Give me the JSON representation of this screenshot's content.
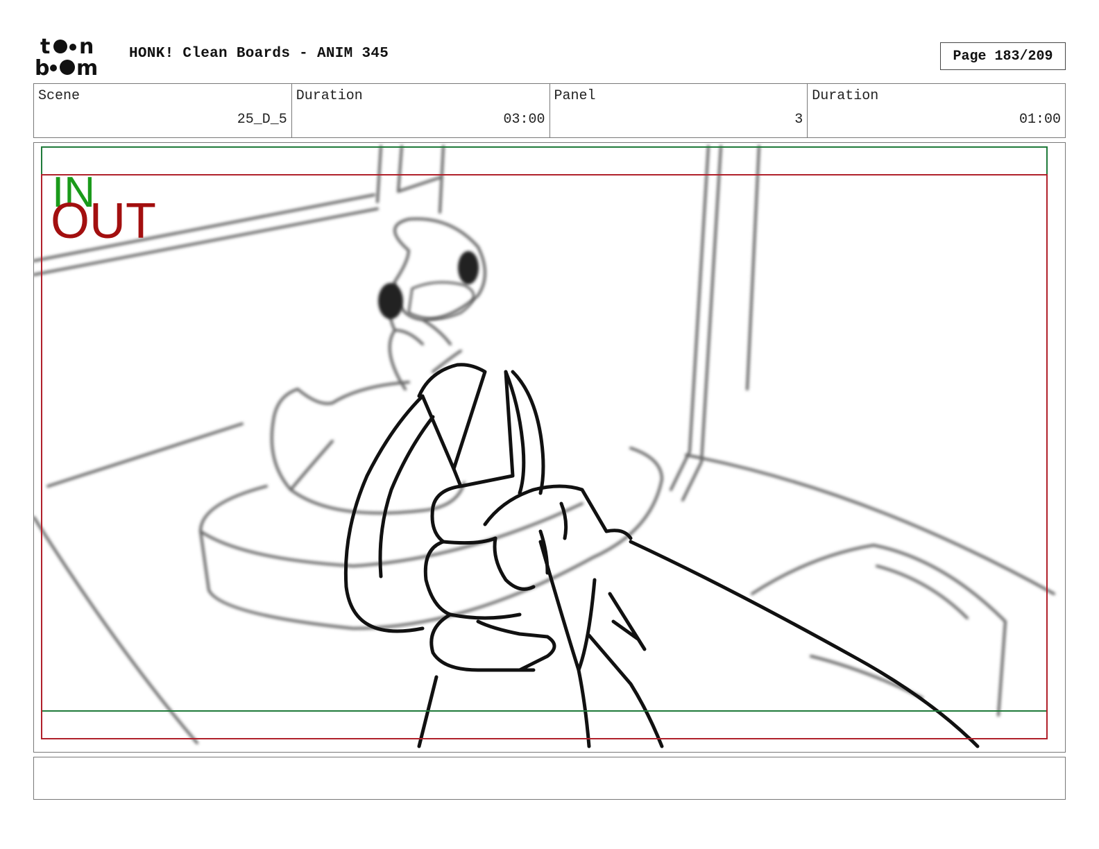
{
  "header": {
    "logo_text": "toon boom",
    "title": "HONK! Clean Boards - ANIM 345",
    "page": "Page 183/209"
  },
  "info": {
    "scene_label": "Scene",
    "scene_value": "25_D_5",
    "scene_duration_label": "Duration",
    "scene_duration_value": "03:00",
    "panel_label": "Panel",
    "panel_value": "3",
    "panel_duration_label": "Duration",
    "panel_duration_value": "01:00"
  },
  "panel": {
    "in_label": "IN",
    "out_label": "OUT",
    "in_color": "#1a9a1a",
    "out_color": "#a30f0f",
    "in_frame_color": "#1f7a3a",
    "out_frame_color": "#b0202a"
  },
  "notes": {
    "text": ""
  }
}
